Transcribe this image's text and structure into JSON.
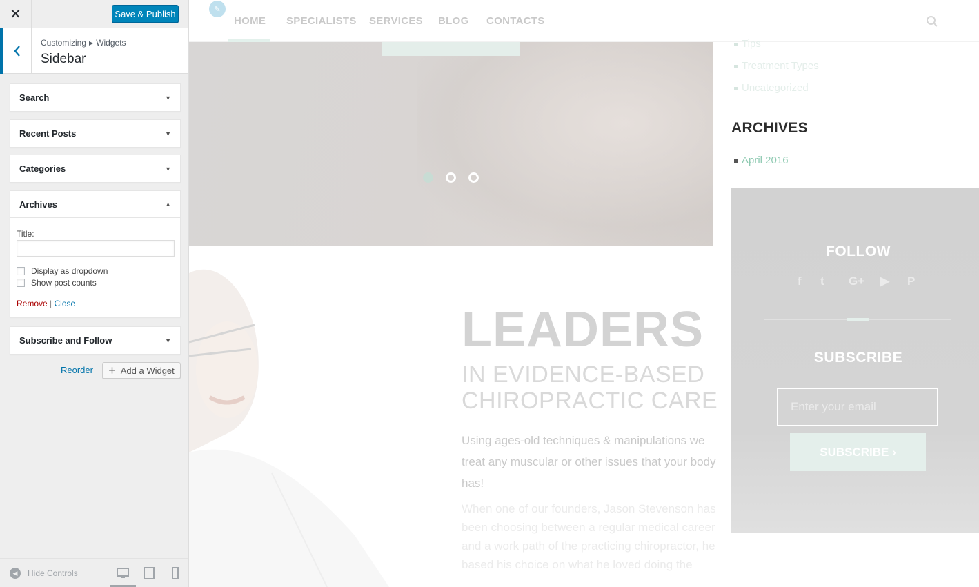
{
  "customizer": {
    "close_label": "✕",
    "save_label": "Save & Publish",
    "breadcrumb": [
      "Customizing",
      "Widgets"
    ],
    "section_title": "Sidebar",
    "widgets": [
      {
        "title": "Search"
      },
      {
        "title": "Recent Posts"
      },
      {
        "title": "Categories"
      },
      {
        "title": "Archives"
      },
      {
        "title": "Subscribe and Follow"
      }
    ],
    "archives_form": {
      "title_label": "Title:",
      "title_value": "",
      "checkbox_dropdown": "Display as dropdown",
      "checkbox_counts": "Show post counts",
      "remove_label": "Remove",
      "separator": "|",
      "close_label": "Close"
    },
    "reorder_label": "Reorder",
    "add_widget_label": "Add a Widget",
    "hide_controls_label": "Hide Controls"
  },
  "preview": {
    "nav": {
      "items": [
        "HOME",
        "SPECIALISTS",
        "SERVICES",
        "BLOG",
        "CONTACTS"
      ]
    },
    "categories": [
      "Tips",
      "Treatment Types",
      "Uncategorized"
    ],
    "archives_heading": "ARCHIVES",
    "archive_items": [
      "April 2016"
    ],
    "follow_title": "FOLLOW",
    "social_icons": [
      "facebook-icon",
      "twitter-icon",
      "google-plus-icon",
      "youtube-icon",
      "pinterest-icon"
    ],
    "social_glyphs": [
      "f",
      "t",
      "G+",
      "▶",
      "P"
    ],
    "subscribe_title": "SUBSCRIBE",
    "email_placeholder": "Enter your email",
    "subscribe_button": "SUBSCRIBE",
    "subscribe_chevron": "›",
    "headline": "LEADERS",
    "subheadline": "IN EVIDENCE-BASED CHIROPRACTIC CARE",
    "lead": "Using ages-old techniques & manipulations we treat any muscular or other issues that your body has!",
    "body": "When one of our founders, Jason Stevenson has been choosing between a regular medical career and a work path of the practicing chiropractor, he based his choice on what he loved doing the",
    "slider_dots": 3,
    "active_slide": 1
  },
  "colors": {
    "primary": "#0085ba",
    "link": "#0073aa",
    "remove": "#aa0000",
    "accent_mint": "#8fcab2",
    "panel_bg": "#eeeeee"
  }
}
